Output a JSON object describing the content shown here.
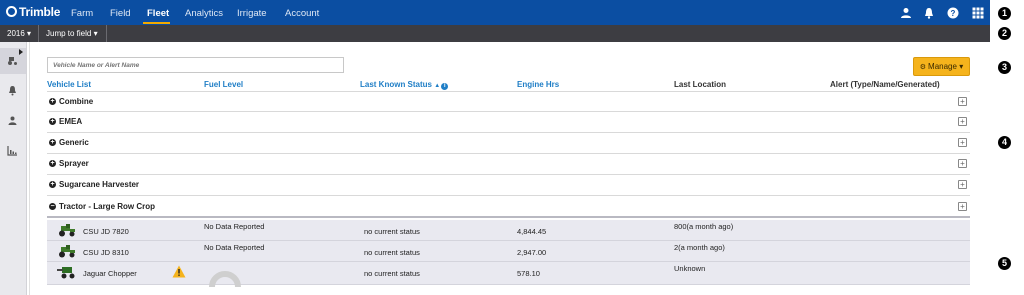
{
  "brand": {
    "name": "Trimble"
  },
  "nav": {
    "items": [
      "Farm",
      "Field",
      "Fleet",
      "Analytics",
      "Irrigate",
      "Account"
    ],
    "active": "Fleet"
  },
  "topbar_icons": [
    "user-icon",
    "bell-icon",
    "help-icon",
    "apps-grid-icon"
  ],
  "subbar": {
    "year": "2016",
    "jump": "Jump to field"
  },
  "callouts": [
    "1",
    "2",
    "3",
    "4",
    "5"
  ],
  "sidebar_icons": [
    "tractor-icon",
    "bell-icon",
    "person-icon",
    "chart-icon"
  ],
  "search": {
    "placeholder": "Vehicle Name or Alert Name"
  },
  "manage": {
    "label": "Manage"
  },
  "columns": {
    "vehicle_list": "Vehicle List",
    "fuel_level": "Fuel Level",
    "last_known_status": "Last Known Status",
    "engine_hrs": "Engine Hrs",
    "last_location": "Last Location",
    "alert": "Alert (Type/Name/Generated)"
  },
  "groups": [
    {
      "name": "Combine",
      "expanded": false
    },
    {
      "name": "EMEA",
      "expanded": false
    },
    {
      "name": "Generic",
      "expanded": false
    },
    {
      "name": "Sprayer",
      "expanded": false
    },
    {
      "name": "Sugarcane Harvester",
      "expanded": false
    },
    {
      "name": "Tractor - Large Row Crop",
      "expanded": true
    }
  ],
  "vehicles": [
    {
      "name": "CSU JD 7820",
      "fuel": "No Data Reported",
      "status": "no current status",
      "engine_hrs": "4,844.45",
      "location": "800(a month ago)"
    },
    {
      "name": "CSU JD 8310",
      "fuel": "No Data Reported",
      "status": "no current status",
      "engine_hrs": "2,947.00",
      "location": "2(a month ago)"
    },
    {
      "name": "Jaguar Chopper",
      "fuel": "",
      "status": "no current status",
      "engine_hrs": "578.10",
      "location": "Unknown"
    }
  ],
  "colors": {
    "nav_bg": "#0b4ea2",
    "subbar_bg": "#3d3d42",
    "accent": "#f5b31c",
    "link": "#1f7ec6"
  }
}
